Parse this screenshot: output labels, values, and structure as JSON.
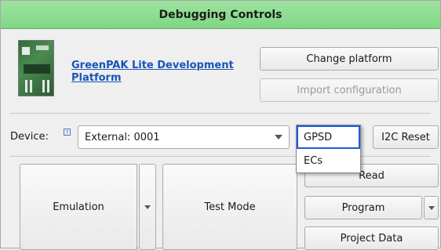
{
  "title": "Debugging Controls",
  "platform": {
    "name": "GreenPAK Lite Development Platform",
    "change_label": "Change platform",
    "import_label": "Import configuration"
  },
  "device": {
    "label": "Device:",
    "help": "?",
    "value": "External: 0001"
  },
  "popup": {
    "items": [
      "GPSD",
      "ECs"
    ],
    "selected": "GPSD"
  },
  "buttons": {
    "i2c_reset": "I2C Reset",
    "emulation": "Emulation",
    "test_mode": "Test Mode",
    "read": "Read",
    "program": "Program",
    "project_data": "Project Data"
  }
}
